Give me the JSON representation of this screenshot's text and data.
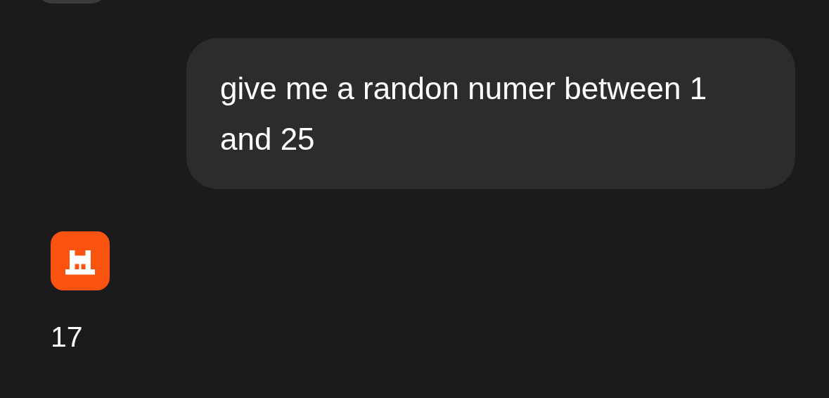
{
  "messages": [
    {
      "kind": "user",
      "text": "give me a randon numer between 1 and 25"
    },
    {
      "kind": "assistant",
      "text": "17"
    }
  ]
}
